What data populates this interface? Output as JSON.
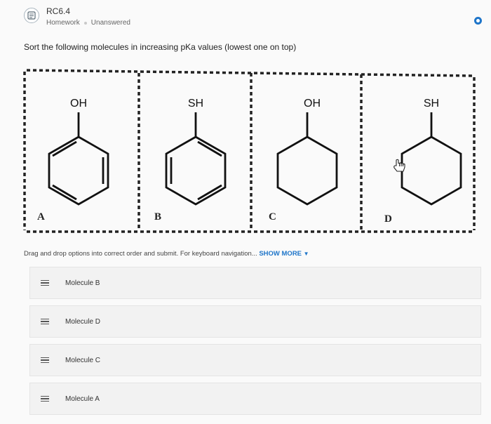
{
  "header": {
    "title": "RC6.4",
    "type": "Homework",
    "status": "Unanswered"
  },
  "question": {
    "prompt": "Sort the following molecules in increasing pKa values (lowest one on top)"
  },
  "figure": {
    "molecules": [
      {
        "letter": "A",
        "group": "OH"
      },
      {
        "letter": "B",
        "group": "SH"
      },
      {
        "letter": "C",
        "group": "OH"
      },
      {
        "letter": "D",
        "group": "SH"
      }
    ]
  },
  "instructions": {
    "text": "Drag and drop options into correct order and submit. For keyboard navigation...",
    "show_more": "SHOW MORE"
  },
  "options": [
    {
      "label": "Molecule B"
    },
    {
      "label": "Molecule D"
    },
    {
      "label": "Molecule C"
    },
    {
      "label": "Molecule A"
    }
  ],
  "colors": {
    "accent": "#1e75c9",
    "item_bg": "#f2f2f2"
  }
}
